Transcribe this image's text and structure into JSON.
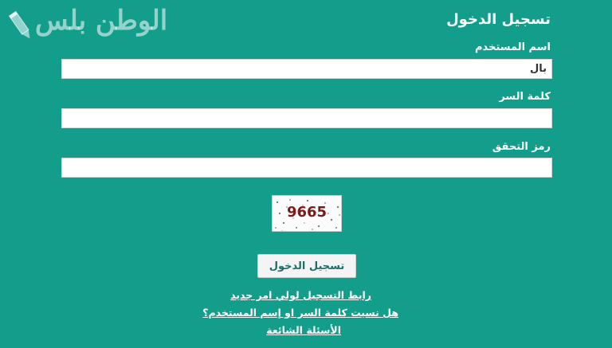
{
  "watermark": {
    "text": "الوطن بلس",
    "icon": "pencil-icon"
  },
  "login": {
    "title": "تسجيل الدخول",
    "username_label": "اسم المستخدم",
    "username_value": "بال",
    "password_label": "كلمة السر",
    "password_value": "",
    "verification_label": "رمز التحقق",
    "verification_value": "",
    "captcha_text": "9665",
    "submit_label": "تسجيل الدخول"
  },
  "links": {
    "register_guardian": "رابط التسجيل لولي امر جديد",
    "forgot": "هل نسيت كلمة السر او إسم المستخدم؟",
    "faq": "الأسئلة الشائعة"
  },
  "colors": {
    "background": "#139e8c",
    "button_text": "#1a6f66",
    "captcha_text": "#7a1a1a"
  }
}
